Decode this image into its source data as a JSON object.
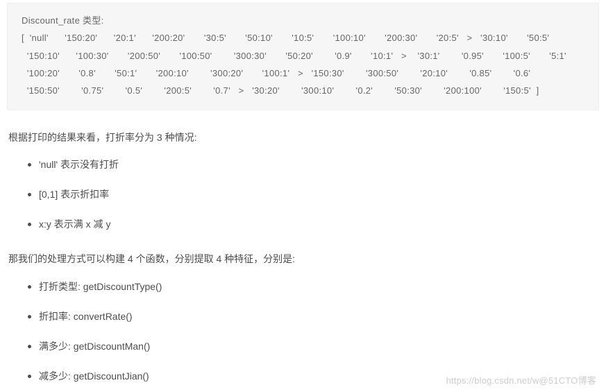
{
  "code": {
    "header": "Discount_rate 类型:",
    "line1": "[  'null'      '150:20'      '20:1'      '200:20'       '30:5'       '50:10'       '10:5'       '100:10'       '200:30'       '20:5'   >   '30:10'       '50:5'",
    "line2": "  '150:10'      '100:30'       '200:50'       '100:50'        '300:30'       '50:20'        '0.9'       '10:1'   >    '30:1'        '0.95'       '100:5'       '5:1'",
    "line3": "  '100:20'       '0.8'       '50:1'       '200:10'        '300:20'       '100:1'   >   '150:30'        '300:50'        '20:10'        '0.85'        '0.6'",
    "line4": "  '150:50'        '0.75'        '0.5'        '200:5'        '0.7'   >   '30:20'        '300:10'        '0.2'        '50:30'        '200:100'        '150:5'  ]"
  },
  "para1": "根据打印的结果来看，打折率分为 3 种情况:",
  "list1": {
    "i0": " 'null'  表示没有打折",
    "i1": "[0,1] 表示折扣率",
    "i2": "x:y 表示满 x 减 y"
  },
  "para2": "那我们的处理方式可以构建 4 个函数，分别提取 4 种特征，分别是:",
  "list2": {
    "i0": "打折类型:  getDiscountType()",
    "i1": "折扣率:  convertRate()",
    "i2": "满多少:  getDiscountMan()",
    "i3": "减多少:  getDiscountJian()"
  },
  "watermark": "https://blog.csdn.net/w@51CTO博客"
}
